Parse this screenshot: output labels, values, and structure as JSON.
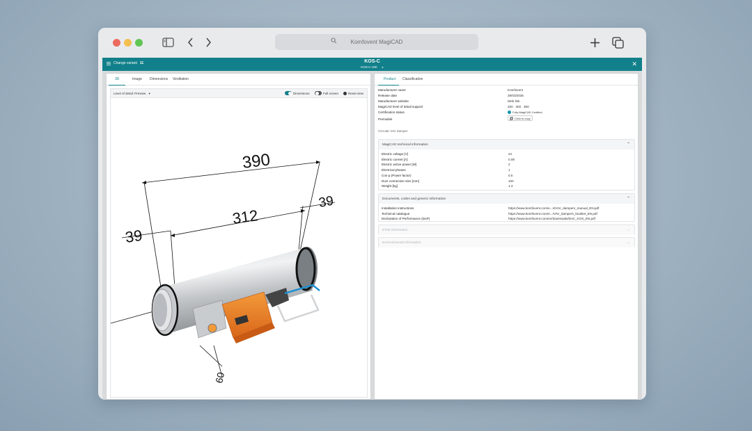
{
  "browser": {
    "address": "Komfovent MagiCAD",
    "icons": [
      "sidebar-icon",
      "back-icon",
      "forward-icon",
      "search-icon",
      "new-tab-icon",
      "tabs-overview-icon"
    ]
  },
  "app": {
    "change_variant_label": "Change variant",
    "variant_count": "11",
    "title": "KOS-C",
    "subtitle": "KOS-C-100",
    "accent_color": "#12808a"
  },
  "left_panel": {
    "tabs": [
      "3D",
      "Image",
      "Dimensions",
      "Ventilation"
    ],
    "active_tab": "3D",
    "level_of_detail_label": "Level of detail: Preview",
    "toggles": [
      {
        "label": "Dimensions",
        "on": true
      },
      {
        "label": "Full screen",
        "on": false
      }
    ],
    "reset_view_label": "Reset view",
    "dimension_labels": [
      "390",
      "312",
      "39",
      "39",
      "60"
    ]
  },
  "right_panel": {
    "tabs": [
      "Product",
      "Classification"
    ],
    "active_tab": "Product",
    "product_fields": [
      {
        "label": "Manufacturer name",
        "value": "Komfovent"
      },
      {
        "label": "Release date",
        "value": "28/03/2025"
      },
      {
        "label": "Manufacturer website",
        "value": "Web link"
      },
      {
        "label": "MagiCAD level of detail support",
        "value": "200   300   350"
      },
      {
        "label": "Certification status",
        "value": "Fully MagiCAD Certified"
      },
      {
        "label": "Permalink",
        "value": "Click to copy"
      }
    ],
    "description": "Circular VAV damper",
    "sections": [
      {
        "title": "MagiCAD technical information",
        "rows": [
          {
            "label": "Electric voltage [V]",
            "value": "24"
          },
          {
            "label": "Electric current [A]",
            "value": "0.08"
          },
          {
            "label": "Electric active power [W]",
            "value": "2"
          },
          {
            "label": "Electrical phases",
            "value": "1"
          },
          {
            "label": "Cos φ (Power factor)",
            "value": "0.5"
          },
          {
            "label": "Duct connection size [mm]",
            "value": "100"
          },
          {
            "label": "Weight [kg]",
            "value": "1.3"
          }
        ]
      },
      {
        "title": "Documents, codes and generic information",
        "rows": [
          {
            "label": "Installation instructions",
            "value": "https://www.komfovent.com/e...s/VAV_dampers_manual_EN.pdf"
          },
          {
            "label": "Technical catalogue",
            "value": "https://www.komfovent.com/e.../VAV_dampers_booklet_EN.pdf"
          },
          {
            "label": "Declaration of Performance (DoP)",
            "value": "https://www.komfovent.com/en/downloads/DoC_KOS_EN.pdf"
          }
        ]
      },
      {
        "title": "ETIM information",
        "rows": []
      },
      {
        "title": "Environmental information",
        "rows": []
      }
    ]
  }
}
